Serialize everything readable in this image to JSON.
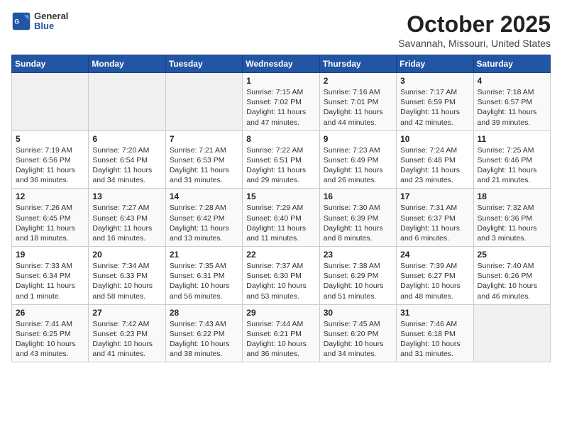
{
  "logo": {
    "line1": "General",
    "line2": "Blue"
  },
  "title": "October 2025",
  "subtitle": "Savannah, Missouri, United States",
  "days_of_week": [
    "Sunday",
    "Monday",
    "Tuesday",
    "Wednesday",
    "Thursday",
    "Friday",
    "Saturday"
  ],
  "weeks": [
    [
      {
        "day": "",
        "info": ""
      },
      {
        "day": "",
        "info": ""
      },
      {
        "day": "",
        "info": ""
      },
      {
        "day": "1",
        "info": "Sunrise: 7:15 AM\nSunset: 7:02 PM\nDaylight: 11 hours and 47 minutes."
      },
      {
        "day": "2",
        "info": "Sunrise: 7:16 AM\nSunset: 7:01 PM\nDaylight: 11 hours and 44 minutes."
      },
      {
        "day": "3",
        "info": "Sunrise: 7:17 AM\nSunset: 6:59 PM\nDaylight: 11 hours and 42 minutes."
      },
      {
        "day": "4",
        "info": "Sunrise: 7:18 AM\nSunset: 6:57 PM\nDaylight: 11 hours and 39 minutes."
      }
    ],
    [
      {
        "day": "5",
        "info": "Sunrise: 7:19 AM\nSunset: 6:56 PM\nDaylight: 11 hours and 36 minutes."
      },
      {
        "day": "6",
        "info": "Sunrise: 7:20 AM\nSunset: 6:54 PM\nDaylight: 11 hours and 34 minutes."
      },
      {
        "day": "7",
        "info": "Sunrise: 7:21 AM\nSunset: 6:53 PM\nDaylight: 11 hours and 31 minutes."
      },
      {
        "day": "8",
        "info": "Sunrise: 7:22 AM\nSunset: 6:51 PM\nDaylight: 11 hours and 29 minutes."
      },
      {
        "day": "9",
        "info": "Sunrise: 7:23 AM\nSunset: 6:49 PM\nDaylight: 11 hours and 26 minutes."
      },
      {
        "day": "10",
        "info": "Sunrise: 7:24 AM\nSunset: 6:48 PM\nDaylight: 11 hours and 23 minutes."
      },
      {
        "day": "11",
        "info": "Sunrise: 7:25 AM\nSunset: 6:46 PM\nDaylight: 11 hours and 21 minutes."
      }
    ],
    [
      {
        "day": "12",
        "info": "Sunrise: 7:26 AM\nSunset: 6:45 PM\nDaylight: 11 hours and 18 minutes."
      },
      {
        "day": "13",
        "info": "Sunrise: 7:27 AM\nSunset: 6:43 PM\nDaylight: 11 hours and 16 minutes."
      },
      {
        "day": "14",
        "info": "Sunrise: 7:28 AM\nSunset: 6:42 PM\nDaylight: 11 hours and 13 minutes."
      },
      {
        "day": "15",
        "info": "Sunrise: 7:29 AM\nSunset: 6:40 PM\nDaylight: 11 hours and 11 minutes."
      },
      {
        "day": "16",
        "info": "Sunrise: 7:30 AM\nSunset: 6:39 PM\nDaylight: 11 hours and 8 minutes."
      },
      {
        "day": "17",
        "info": "Sunrise: 7:31 AM\nSunset: 6:37 PM\nDaylight: 11 hours and 6 minutes."
      },
      {
        "day": "18",
        "info": "Sunrise: 7:32 AM\nSunset: 6:36 PM\nDaylight: 11 hours and 3 minutes."
      }
    ],
    [
      {
        "day": "19",
        "info": "Sunrise: 7:33 AM\nSunset: 6:34 PM\nDaylight: 11 hours and 1 minute."
      },
      {
        "day": "20",
        "info": "Sunrise: 7:34 AM\nSunset: 6:33 PM\nDaylight: 10 hours and 58 minutes."
      },
      {
        "day": "21",
        "info": "Sunrise: 7:35 AM\nSunset: 6:31 PM\nDaylight: 10 hours and 56 minutes."
      },
      {
        "day": "22",
        "info": "Sunrise: 7:37 AM\nSunset: 6:30 PM\nDaylight: 10 hours and 53 minutes."
      },
      {
        "day": "23",
        "info": "Sunrise: 7:38 AM\nSunset: 6:29 PM\nDaylight: 10 hours and 51 minutes."
      },
      {
        "day": "24",
        "info": "Sunrise: 7:39 AM\nSunset: 6:27 PM\nDaylight: 10 hours and 48 minutes."
      },
      {
        "day": "25",
        "info": "Sunrise: 7:40 AM\nSunset: 6:26 PM\nDaylight: 10 hours and 46 minutes."
      }
    ],
    [
      {
        "day": "26",
        "info": "Sunrise: 7:41 AM\nSunset: 6:25 PM\nDaylight: 10 hours and 43 minutes."
      },
      {
        "day": "27",
        "info": "Sunrise: 7:42 AM\nSunset: 6:23 PM\nDaylight: 10 hours and 41 minutes."
      },
      {
        "day": "28",
        "info": "Sunrise: 7:43 AM\nSunset: 6:22 PM\nDaylight: 10 hours and 38 minutes."
      },
      {
        "day": "29",
        "info": "Sunrise: 7:44 AM\nSunset: 6:21 PM\nDaylight: 10 hours and 36 minutes."
      },
      {
        "day": "30",
        "info": "Sunrise: 7:45 AM\nSunset: 6:20 PM\nDaylight: 10 hours and 34 minutes."
      },
      {
        "day": "31",
        "info": "Sunrise: 7:46 AM\nSunset: 6:18 PM\nDaylight: 10 hours and 31 minutes."
      },
      {
        "day": "",
        "info": ""
      }
    ]
  ]
}
